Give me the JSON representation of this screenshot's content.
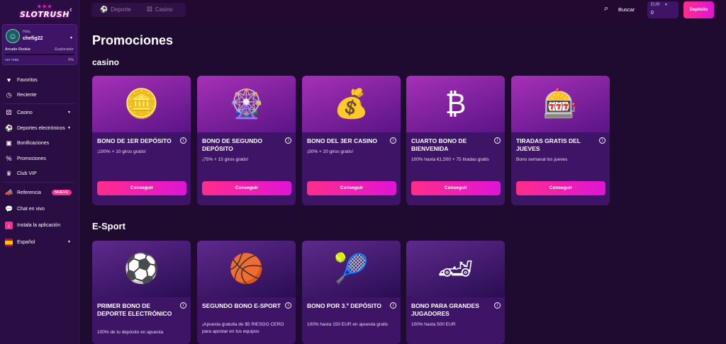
{
  "brand": {
    "logo": "SLOTRUSH"
  },
  "user": {
    "greeting": "Hola,",
    "name": "chefig22",
    "rank": "Arcade Rookie",
    "next_rank": "Explorador",
    "more": "ver más",
    "progress": "0%",
    "progress_value": 0
  },
  "sidebar": {
    "items": [
      {
        "label": "Favoritos",
        "icon": "heart-icon"
      },
      {
        "label": "Reciente",
        "icon": "clock-icon"
      },
      {
        "label": "Casino",
        "icon": "dice-icon"
      },
      {
        "label": "Deportes electrónicos",
        "icon": "ball-icon"
      },
      {
        "label": "Bonificaciones",
        "icon": "bonus-icon"
      },
      {
        "label": "Promociones",
        "icon": "ticket-icon"
      },
      {
        "label": "Club VIP",
        "icon": "crown-icon"
      },
      {
        "label": "Referencia",
        "icon": "megaphone-icon",
        "badge": "NUEVO"
      },
      {
        "label": "Chat en vivo",
        "icon": "chat-icon"
      },
      {
        "label": "Instala la aplicación",
        "icon": "download-icon"
      },
      {
        "label": "Español",
        "icon": "flag-icon"
      }
    ]
  },
  "topbar": {
    "tabs": [
      {
        "label": "Deporte"
      },
      {
        "label": "Casino"
      }
    ],
    "search": "Buscar",
    "currency": "EUR",
    "balance": "0",
    "deposit": "Depósito"
  },
  "page": {
    "title": "Promociones",
    "section_casino": "casino",
    "section_esport": "E-Sport"
  },
  "casino_cards": [
    {
      "title": "BONO DE 1ER DEPÓSITO",
      "desc": "¡100% + 10 giros gratis!",
      "button": "Conseguir"
    },
    {
      "title": "BONO DE SEGUNDO DEPÓSITO",
      "desc": "¡75% + 15 giros gratis!",
      "button": "Conseguir"
    },
    {
      "title": "BONO DEL 3ER CASINO",
      "desc": "¡50% + 20 giros gratis!",
      "button": "Conseguir"
    },
    {
      "title": "CUARTO BONO DE BIENVENIDA",
      "desc": "100% hasta €1,500 + 75 tiradas gratis",
      "button": "Conseguir"
    },
    {
      "title": "TIRADAS GRATIS DEL JUEVES",
      "desc": "Bono semanal los jueves",
      "button": "Conseguir"
    }
  ],
  "esport_cards": [
    {
      "title": "PRIMER BONO DE DEPORTE ELECTRÓNICO",
      "desc": "100% de tu depósito en apuesta"
    },
    {
      "title": "SEGUNDO BONO E-SPORT",
      "desc": "¡Apuesta gratuita de $5 RIESGO CERO para apostar en tus equipos"
    },
    {
      "title": "BONO POR 3.º DEPÓSITO",
      "desc": "100% hasta 150 EUR en apuesta gratis"
    },
    {
      "title": "BONO PARA GRANDES JUGADORES",
      "desc": "100% hasta 500 EUR"
    }
  ]
}
